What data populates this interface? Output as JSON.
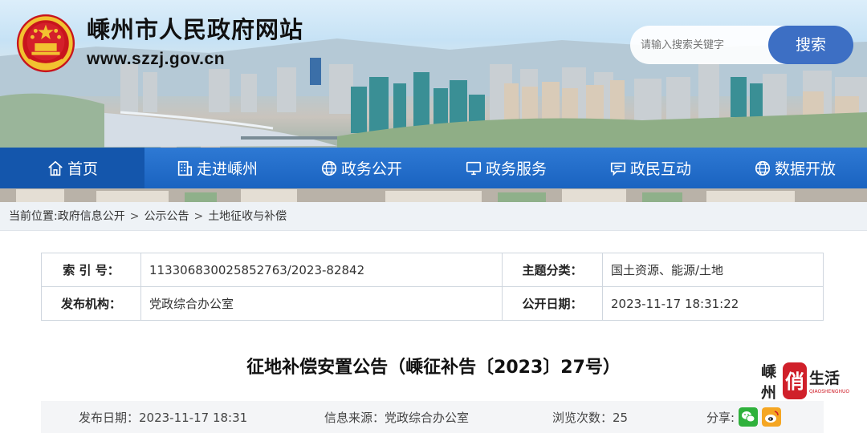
{
  "header": {
    "site_title": "嵊州市人民政府网站",
    "site_url": "www.szzj.gov.cn",
    "search": {
      "placeholder": "请输入搜索关键字",
      "button_label": "搜索"
    }
  },
  "nav": [
    {
      "label": "首页",
      "icon": "home-icon",
      "active": true
    },
    {
      "label": "走进嵊州",
      "icon": "building-icon"
    },
    {
      "label": "政务公开",
      "icon": "globe-icon"
    },
    {
      "label": "政务服务",
      "icon": "monitor-icon"
    },
    {
      "label": "政民互动",
      "icon": "chat-icon"
    },
    {
      "label": "数据开放",
      "icon": "globe-icon"
    }
  ],
  "breadcrumb": {
    "prefix": "当前位置:",
    "items": [
      "政府信息公开",
      "公示公告",
      "土地征收与补偿"
    ],
    "separator": ">"
  },
  "meta": {
    "index_label": "索 引 号：",
    "index_value": "113306830025852763/2023-82842",
    "topic_label": "主题分类：",
    "topic_value": "国土资源、能源/土地",
    "org_label": "发布机构：",
    "org_value": "党政综合办公室",
    "date_label": "公开日期：",
    "date_value": "2023-11-17 18:31:22"
  },
  "article": {
    "title": "征地补偿安置公告（嵊征补告〔2023〕27号）"
  },
  "info": {
    "publish": "发布日期：2023-11-17 18:31",
    "source": "信息来源：党政综合办公室",
    "views": "浏览次数：25",
    "share_label": "分享:",
    "share_icons": [
      "wechat-icon",
      "weibo-icon"
    ]
  },
  "watermark": {
    "text_left": "嵊州",
    "seal": "俏",
    "text_right": "生活",
    "small": "QIAOSHENGHUO"
  },
  "colors": {
    "nav_blue": "#1a63c0",
    "search_blue": "#3d6fc4",
    "seal_red": "#d0202a"
  }
}
